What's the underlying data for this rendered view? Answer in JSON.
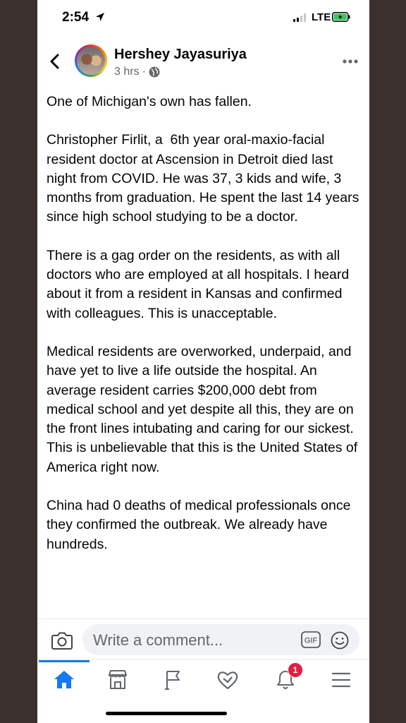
{
  "status_bar": {
    "time": "2:54",
    "network": "LTE"
  },
  "post": {
    "author": "Hershey Jayasuriya",
    "time_ago": "3 hrs",
    "separator": "·",
    "paragraphs": [
      "One of Michigan's own has fallen.",
      "Christopher Firlit, a  6th year oral-maxio-facial resident doctor at Ascension in Detroit died last night from COVID. He was 37, 3 kids and wife, 3 months from graduation. He spent the last 14 years since high school studying to be a doctor.",
      "There is a gag order on the residents, as with all doctors who are employed at all hospitals. I heard about it from a resident in Kansas and confirmed with colleagues. This is unacceptable.",
      "Medical residents are overworked, underpaid, and have yet to live a life outside the hospital. An average resident carries $200,000 debt from medical school and yet despite all this, they are on the front lines intubating and caring for our sickest. This is unbelievable that this is the United States of America right now.",
      "China had 0 deaths of medical professionals once they confirmed the outbreak. We already have hundreds."
    ]
  },
  "comment_bar": {
    "placeholder": "Write a comment...",
    "gif_label": "GIF"
  },
  "tabbar": {
    "active_tab": "home",
    "notification_count": "1",
    "accent_color": "#1877f2",
    "badge_color": "#e41e3f"
  }
}
